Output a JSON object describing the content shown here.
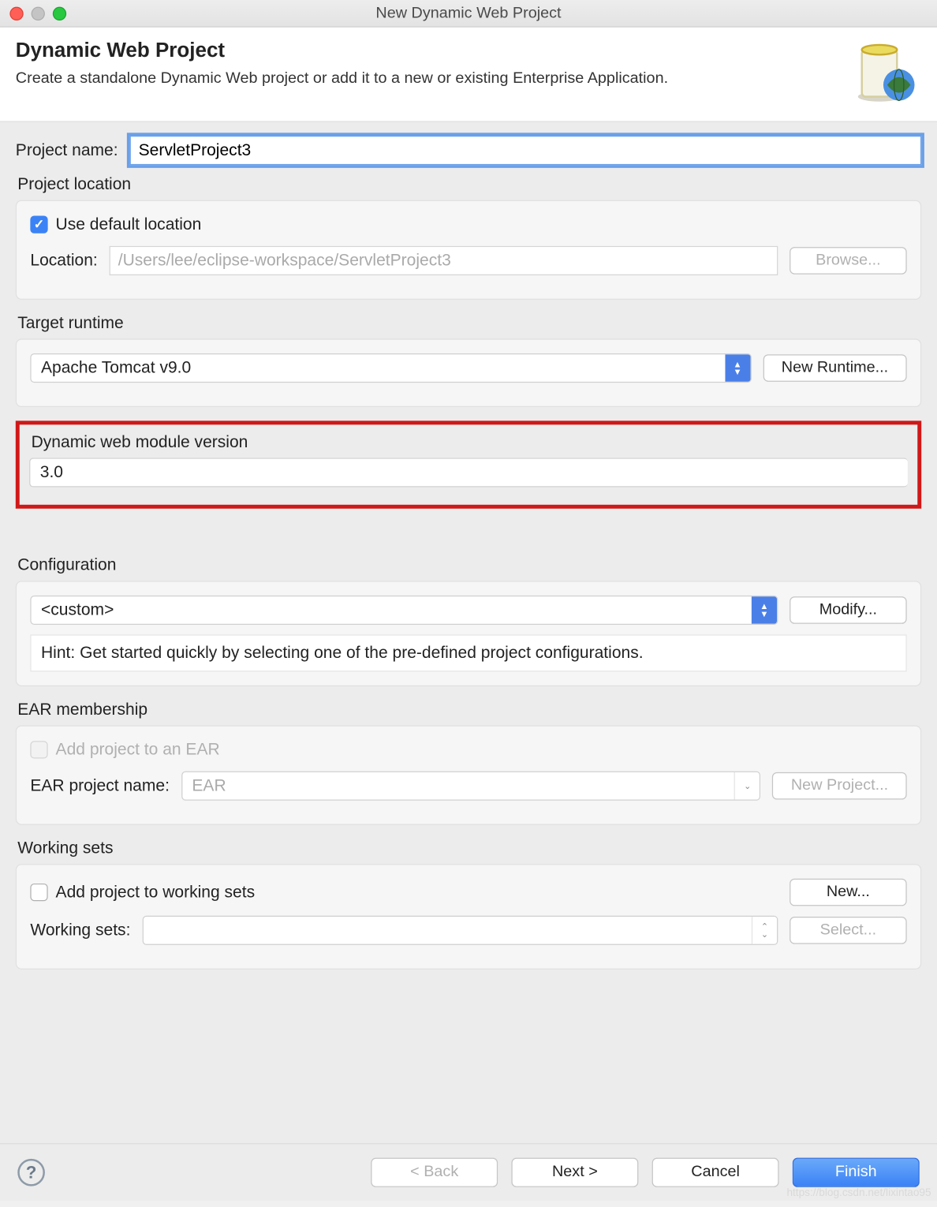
{
  "window": {
    "title": "New Dynamic Web Project"
  },
  "header": {
    "title": "Dynamic Web Project",
    "subtitle": "Create a standalone Dynamic Web project or add it to a new or existing Enterprise Application."
  },
  "project_name": {
    "label": "Project name:",
    "value": "ServletProject3"
  },
  "project_location": {
    "title": "Project location",
    "use_default_label": "Use default location",
    "use_default_checked": true,
    "location_label": "Location:",
    "location_value": "/Users/lee/eclipse-workspace/ServletProject3",
    "browse_label": "Browse..."
  },
  "target_runtime": {
    "title": "Target runtime",
    "selected": "Apache Tomcat v9.0",
    "new_runtime_label": "New Runtime..."
  },
  "web_module": {
    "title": "Dynamic web module version",
    "selected": "3.0"
  },
  "configuration": {
    "title": "Configuration",
    "selected": "<custom>",
    "modify_label": "Modify...",
    "hint": "Hint: Get started quickly by selecting one of the pre-defined project configurations."
  },
  "ear": {
    "title": "EAR membership",
    "add_label": "Add project to an EAR",
    "project_name_label": "EAR project name:",
    "project_name_value": "EAR",
    "new_project_label": "New Project..."
  },
  "working_sets": {
    "title": "Working sets",
    "add_label": "Add project to working sets",
    "new_label": "New...",
    "label": "Working sets:",
    "select_label": "Select..."
  },
  "footer": {
    "back": "< Back",
    "next": "Next >",
    "cancel": "Cancel",
    "finish": "Finish"
  },
  "watermark": "https://blog.csdn.net/lixintao95"
}
